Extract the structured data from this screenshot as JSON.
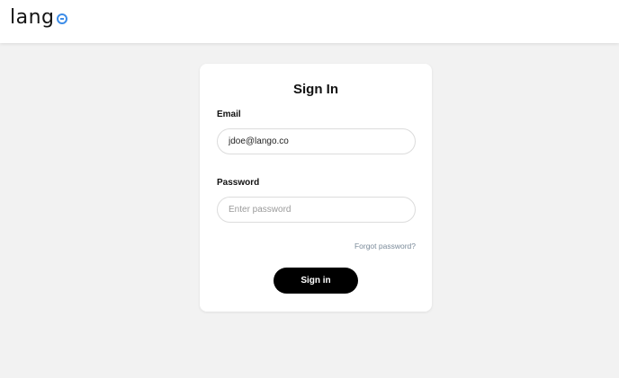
{
  "brand": {
    "name": "lang",
    "accent_color": "#3d8de8"
  },
  "signin": {
    "title": "Sign In",
    "email": {
      "label": "Email",
      "value": "jdoe@lango.co",
      "placeholder": ""
    },
    "password": {
      "label": "Password",
      "value": "",
      "placeholder": "Enter password"
    },
    "forgot_label": "Forgot password?",
    "submit_label": "Sign in"
  },
  "colors": {
    "page_bg": "#f2f2f2",
    "card_bg": "#ffffff",
    "button_bg": "#000000",
    "link": "#7a8a99"
  }
}
